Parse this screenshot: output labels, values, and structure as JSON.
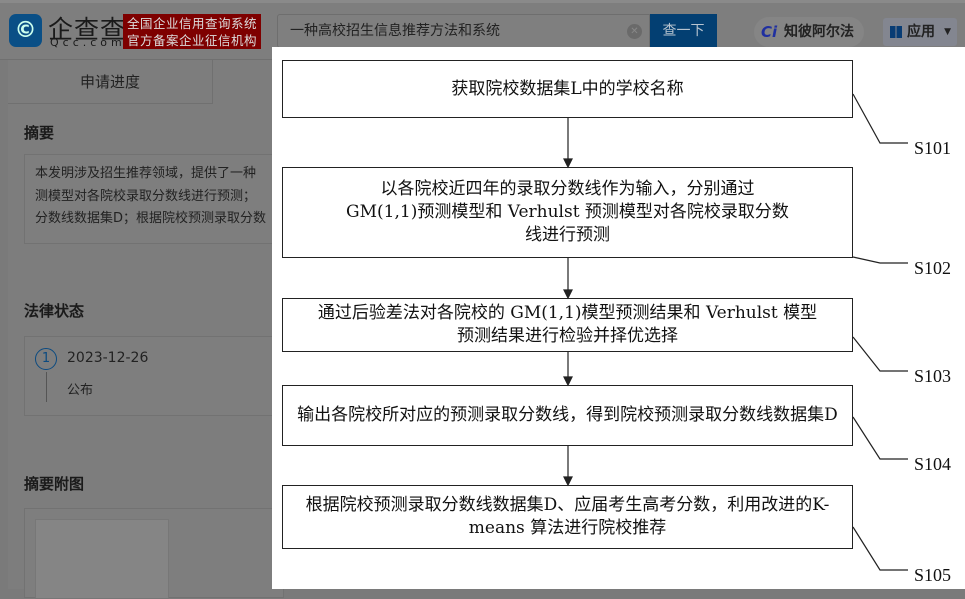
{
  "header": {
    "logo_name": "企查查",
    "logo_domain": "Qcc.com",
    "slogan_line1": "全国企业信用查询系统",
    "slogan_line2": "官方备案企业征信机构",
    "search_value": "一种高校招生信息推荐方法和系统",
    "search_button": "查一下",
    "zhibi_label": "知彼阿尔法",
    "apps_label": "应用"
  },
  "sidebar": {
    "tab_label": "申请进度",
    "abstract_title": "摘要",
    "abstract_lines": [
      "本发明涉及招生推荐领域，提供了一种",
      "测模型对各院校录取分数线进行预测；",
      "分数线数据集D；根据院校预测录取分数"
    ],
    "legal_title": "法律状态",
    "legal_step": "1",
    "legal_date": "2023-12-26",
    "legal_status": "公布",
    "figure_title": "摘要附图"
  },
  "flowchart": {
    "steps": [
      {
        "text": "获取院校数据集L中的学校名称",
        "label": "S101"
      },
      {
        "text": "以各院校近四年的录取分数线作为输入，分别通过 GM(1,1)预测模型和 Verhulst 预测模型对各院校录取分数线进行预测",
        "label": "S102"
      },
      {
        "text": "通过后验差法对各院校的 GM(1,1)模型预测结果和 Verhulst 模型预测结果进行检验并择优选择",
        "label": "S103"
      },
      {
        "text": "输出各院校所对应的预测录取分数线，得到院校预测录取分数线数据集D",
        "label": "S104"
      },
      {
        "text": "根据院校预测录取分数线数据集D、应届考生高考分数，利用改进的K-means 算法进行院校推荐",
        "label": "S105"
      }
    ]
  }
}
